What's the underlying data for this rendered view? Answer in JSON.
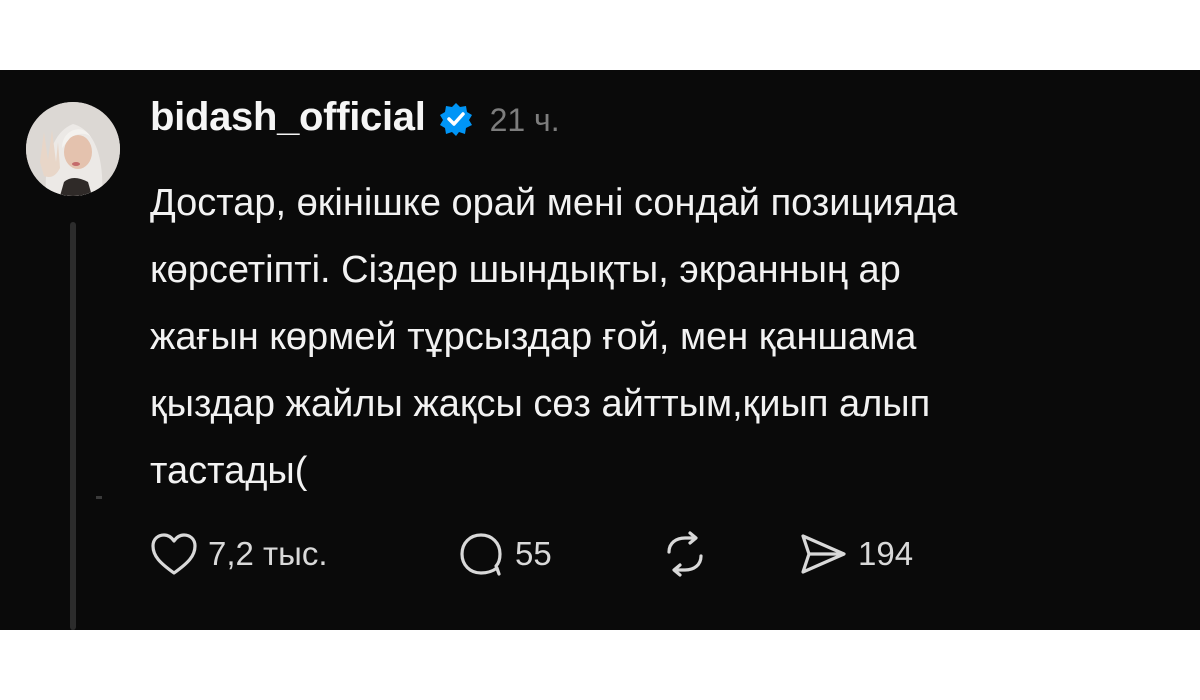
{
  "post": {
    "username": "bidash_official",
    "timestamp": "21 ч.",
    "lines": [
      "Достар, өкінішке орай мені сондай позицияда",
      "көрсетіпті. Сіздер шындықты, экранның ар",
      "жағын көрмей тұрсыздар ғой, мен қаншама",
      "қыздар жайлы жақсы сөз айттым,қиып алып",
      "тастады("
    ]
  },
  "actions": {
    "likes": "7,2 тыс.",
    "comments": "55",
    "shares": "194"
  },
  "icons": {
    "verified": "verified-badge-icon",
    "like": "heart-icon",
    "comment": "speech-bubble-icon",
    "repost": "repost-arrows-icon",
    "share": "paper-plane-icon"
  },
  "colors": {
    "background": "#0a0a0a",
    "text": "#f2f2f2",
    "muted": "#7d7d7d",
    "verified": "#0095f6"
  }
}
